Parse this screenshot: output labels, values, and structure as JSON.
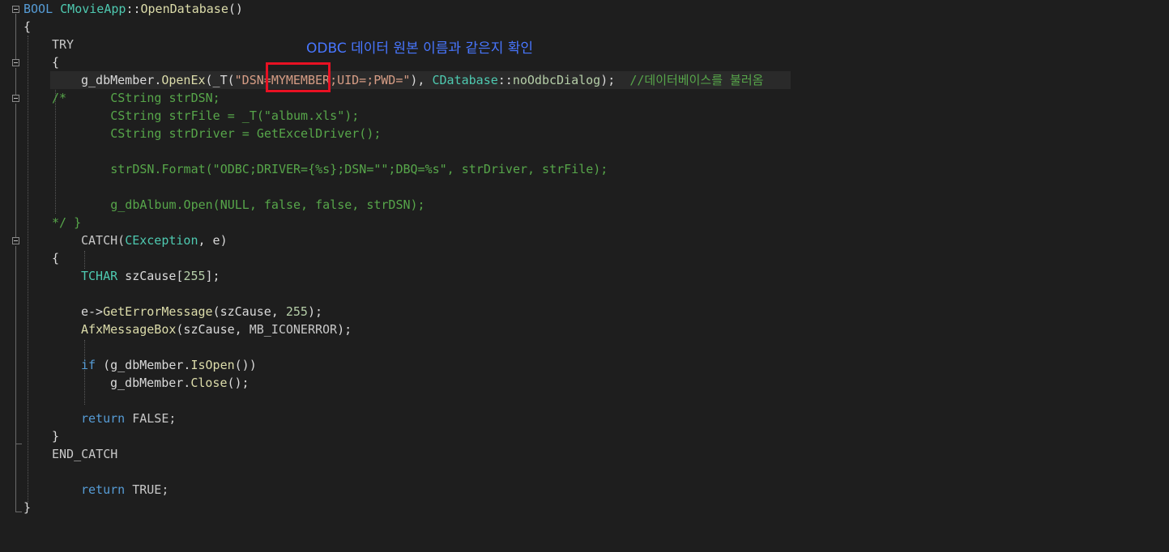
{
  "annotation": "ODBC 데이터 원본 이름과 같은지 확인",
  "code": {
    "l1": {
      "a": "BOOL ",
      "b": "CMovieApp",
      "c": "::",
      "d": "OpenDatabase",
      "e": "()"
    },
    "l2": "{",
    "l3": "TRY",
    "l4": "{",
    "l5": {
      "a": "g_dbMember",
      "b": ".",
      "c": "OpenEx",
      "d": "(_T(",
      "e": "\"DSN=",
      "f": "MYMEMBER",
      "g": ";UID=;PWD=\"",
      "h": "), ",
      "i": "CDatabase",
      "j": "::",
      "k": "noOdbcDialog",
      "l": ");  ",
      "m": "//데이터베이스를 불러옴"
    },
    "l6": "/*      CString strDSN;",
    "l7": "        CString strFile = _T(\"album.xls\");",
    "l8": "        CString strDriver = GetExcelDriver();",
    "l10": "        strDSN.Format(\"ODBC;DRIVER={%s};DSN=\"\";DBQ=%s\", strDriver, strFile);",
    "l12": "        g_dbAlbum.Open(NULL, false, false, strDSN);",
    "l13": "*/ }",
    "l14": {
      "a": "CATCH(",
      "b": "CException",
      "c": ", e)"
    },
    "l15": "{",
    "l16": {
      "a": "TCHAR",
      "b": " szCause[",
      "c": "255",
      "d": "];"
    },
    "l18": {
      "a": "e->",
      "b": "GetErrorMessage",
      "c": "(szCause, ",
      "d": "255",
      "e": ");"
    },
    "l19": {
      "a": "AfxMessageBox",
      "b": "(szCause, ",
      "c": "MB_ICONERROR",
      "d": ");"
    },
    "l21": {
      "a": "if",
      "b": " (g_dbMember.",
      "c": "IsOpen",
      "d": "())"
    },
    "l22": {
      "a": "g_dbMember.",
      "b": "Close",
      "c": "();"
    },
    "l24": {
      "a": "return",
      "b": " FALSE;"
    },
    "l25": "}",
    "l26": "END_CATCH",
    "l28": {
      "a": "return",
      "b": " TRUE;"
    },
    "l29": "}"
  },
  "colors": {
    "background": "#1e1e1e",
    "highlight_box": "#e81123",
    "annotation": "#4876ff",
    "comment": "#57a64a"
  }
}
